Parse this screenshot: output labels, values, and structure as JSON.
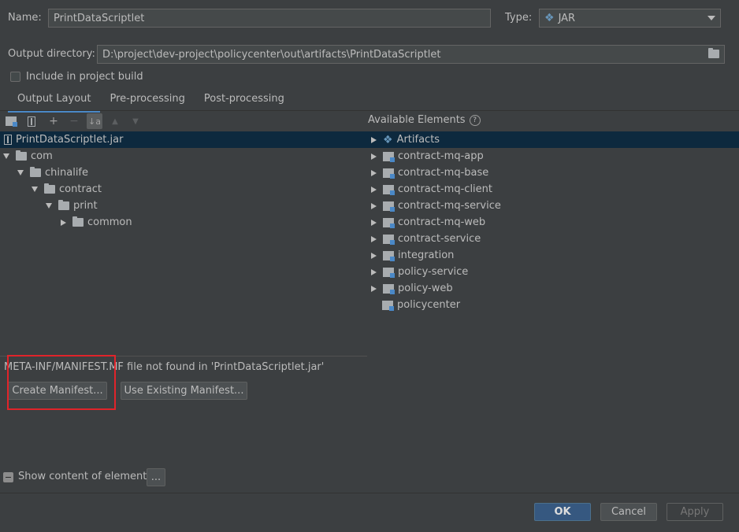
{
  "form": {
    "name_label": "Name:",
    "name_value": "PrintDataScriptlet",
    "type_label": "Type:",
    "type_value": "JAR",
    "output_label": "Output directory:",
    "output_value": "D:\\project\\dev-project\\policycenter\\out\\artifacts\\PrintDataScriptlet",
    "include_label": "Include in project build"
  },
  "tabs": [
    "Output Layout",
    "Pre-processing",
    "Post-processing"
  ],
  "output_tree": {
    "root": "PrintDataScriptlet.jar",
    "nodes": [
      "com",
      "chinalife",
      "contract",
      "print",
      "common"
    ]
  },
  "available": {
    "title": "Available Elements",
    "help": "?",
    "items": [
      "Artifacts",
      "contract-mq-app",
      "contract-mq-base",
      "contract-mq-client",
      "contract-mq-service",
      "contract-mq-web",
      "contract-service",
      "integration",
      "policy-service",
      "policy-web",
      "policycenter"
    ]
  },
  "manifest": {
    "message": "META-INF/MANIFEST.MF file not found in 'PrintDataScriptlet.jar'",
    "create_label": "Create Manifest...",
    "use_existing_label": "Use Existing Manifest..."
  },
  "show_content_label": "Show content of elements",
  "ellipsis_label": "...",
  "footer": {
    "ok": "OK",
    "cancel": "Cancel",
    "apply": "Apply"
  },
  "toolbar": {
    "add": "+",
    "remove": "−",
    "sort": "↓a",
    "up": "▲",
    "down": "▼"
  },
  "icons": {
    "folder": "▬"
  }
}
